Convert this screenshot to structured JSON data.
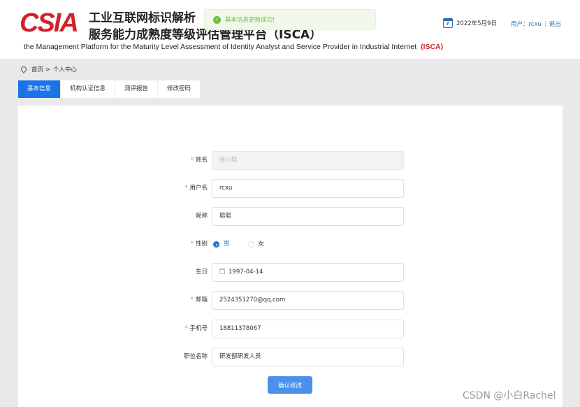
{
  "header": {
    "logo_text": "CSIA",
    "title_line1": "工业互联网标识解析",
    "title_line2": "服务能力成熟度等级评估管理平台（ISCA）",
    "subtitle": "the Management Platform for the Maturity Level Assessment of Identity Analyst and Service Provider in Industrial Internet",
    "subtitle_tag": "(ISCA)",
    "date": "2022年5月9日",
    "calendar_day": "7",
    "user_label": "用户：rcxu",
    "logout": "退出"
  },
  "toast": {
    "message": "基本信息更新成功!",
    "icon": "check-circle-icon"
  },
  "breadcrumb": {
    "home": "首页 >",
    "current": "个人中心"
  },
  "tabs": [
    "基本信息",
    "机构认证信息",
    "测评报告",
    "修改密码"
  ],
  "form": {
    "name": {
      "label": "姓名",
      "required": "*",
      "value": "徐小聪"
    },
    "username": {
      "label": "用户名",
      "required": "*",
      "value": "rcxu"
    },
    "nickname": {
      "label": "昵称",
      "value": "聪聪"
    },
    "gender": {
      "label": "性别",
      "required": "*",
      "options": [
        "男",
        "女"
      ],
      "selected": "男"
    },
    "birthday": {
      "label": "生日",
      "value": "1997-04-14"
    },
    "email": {
      "label": "邮箱",
      "required": "*",
      "value": "2524351270@qq.com"
    },
    "phone": {
      "label": "手机号",
      "required": "*",
      "value": "18811378067"
    },
    "job_title": {
      "label": "职位名称",
      "value": "研发部研发人员"
    },
    "submit": "确认修改"
  },
  "watermark": "CSDN @小白Rachel",
  "colors": {
    "primary": "#1a73e8",
    "brand_red": "#d2232a",
    "success": "#67c23a"
  }
}
